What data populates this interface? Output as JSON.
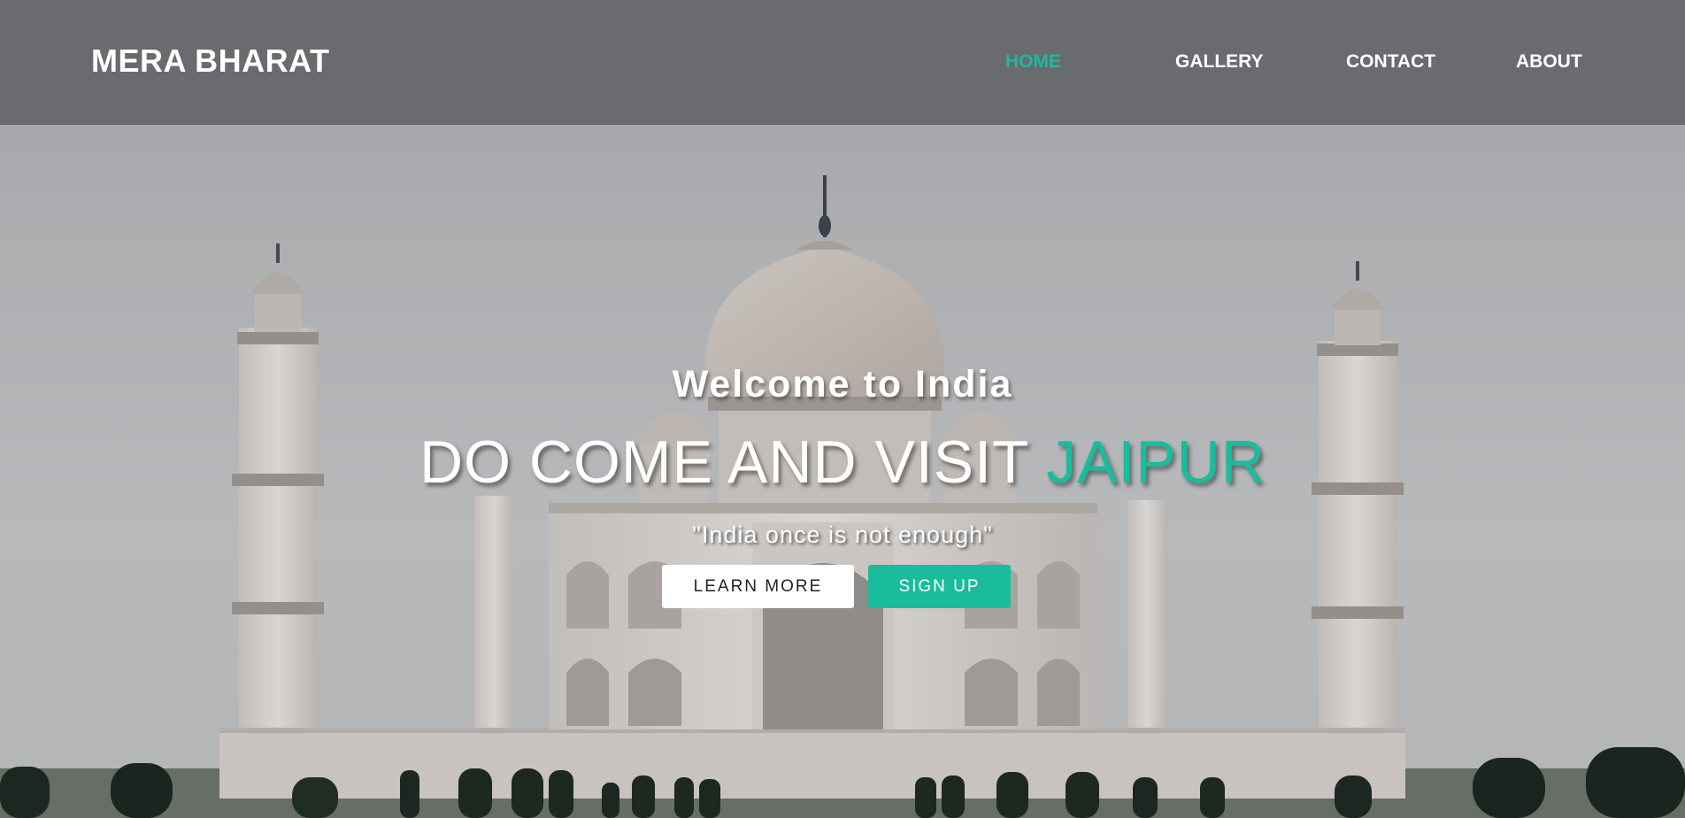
{
  "brand": {
    "name": "MERA BHARAT"
  },
  "nav": {
    "items": [
      {
        "label": "HOME",
        "active": true
      },
      {
        "label": "GALLERY",
        "active": false
      },
      {
        "label": "CONTACT",
        "active": false
      },
      {
        "label": "ABOUT",
        "active": false
      }
    ]
  },
  "hero": {
    "welcome": "Welcome to India",
    "headline_prefix": "DO COME AND VISIT ",
    "headline_accent": "JAIPUR",
    "tagline": "\"India once is not enough\"",
    "learn_more_label": "LEARN MORE",
    "sign_up_label": "SIGN UP",
    "background_image": "taj-mahal-photo"
  },
  "colors": {
    "accent": "#1abc9c",
    "navbar": "#626367",
    "text": "#ffffff"
  }
}
